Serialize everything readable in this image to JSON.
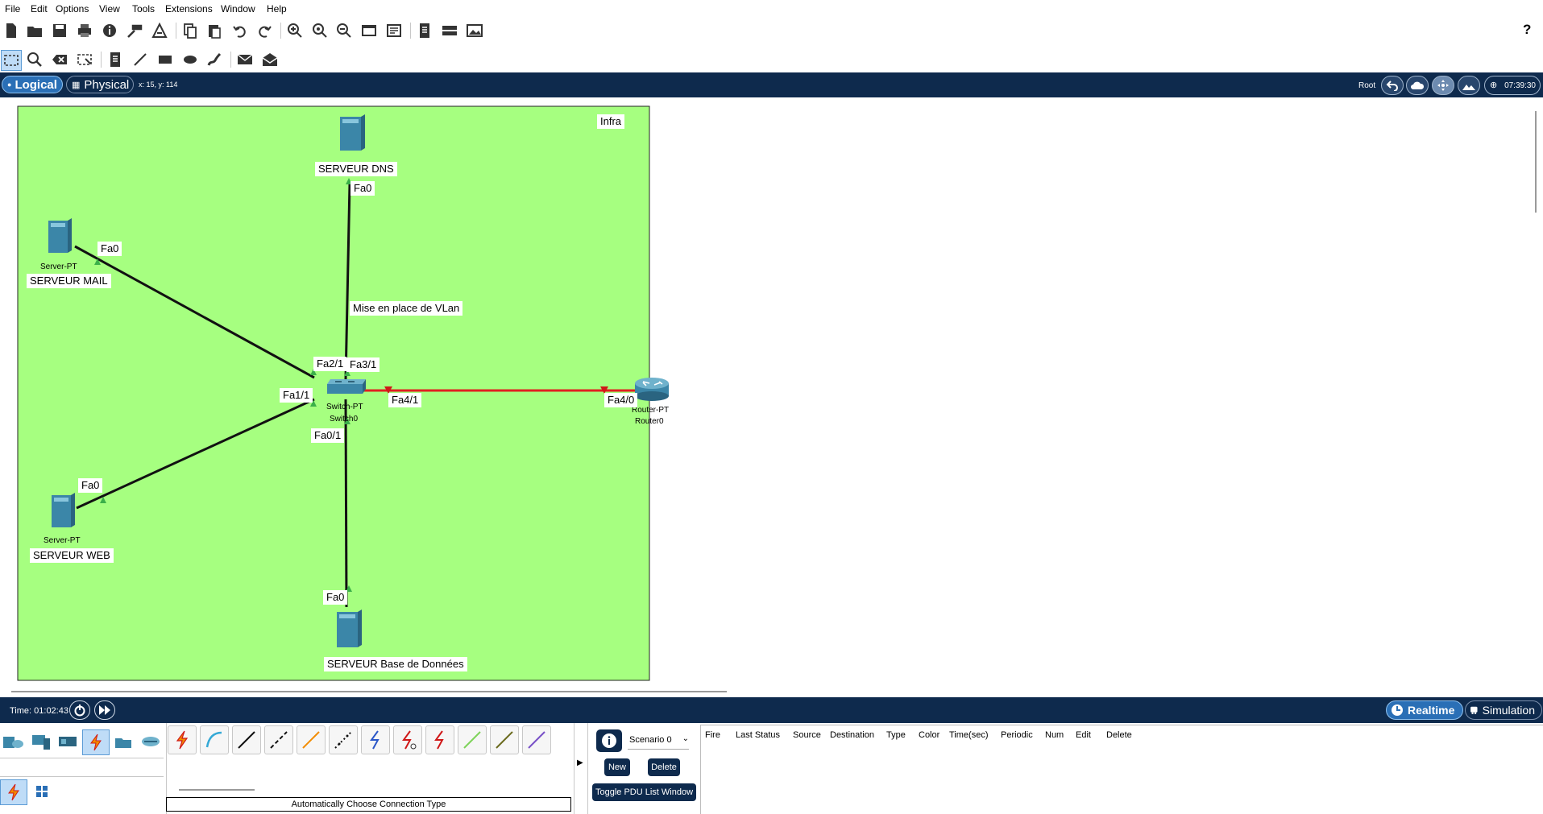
{
  "menu": [
    "File",
    "Edit",
    "Options",
    "View",
    "Tools",
    "Extensions",
    "Window",
    "Help"
  ],
  "help_symbol": "?",
  "mode_tabs": {
    "logical": "Logical",
    "physical": "Physical"
  },
  "coords": "x: 15, y: 114",
  "root_label": "Root",
  "clock": "07:39:30",
  "cluster_label": "Infra",
  "annotation": "Mise en place de VLan",
  "devices": {
    "dns": {
      "name": "SERVEUR DNS"
    },
    "mail": {
      "model": "Server-PT",
      "name": "SERVEUR MAIL"
    },
    "web": {
      "model": "Server-PT",
      "name": "SERVEUR WEB"
    },
    "db": {
      "name": "SERVEUR Base de Données"
    },
    "switch": {
      "model": "Switch-PT",
      "name": "Switch0"
    },
    "router": {
      "model": "Router-PT",
      "name": "Router0"
    }
  },
  "ports": {
    "dns_fa0": "Fa0",
    "mail_fa0": "Fa0",
    "web_fa0": "Fa0",
    "db_fa0": "Fa0",
    "sw_fa21": "Fa2/1",
    "sw_fa31": "Fa3/1",
    "sw_fa11": "Fa1/1",
    "sw_fa41": "Fa4/1",
    "sw_fa01": "Fa0/1",
    "rt_fa40": "Fa4/0"
  },
  "time": "Time: 01:02:43",
  "realtime": "Realtime",
  "simulation": "Simulation",
  "connection_label": "Automatically Choose Connection Type",
  "scenario": {
    "selected": "Scenario 0",
    "new": "New",
    "delete": "Delete",
    "toggle": "Toggle PDU List Window"
  },
  "pdu_columns": [
    "Fire",
    "Last Status",
    "Source",
    "Destination",
    "Type",
    "Color",
    "Time(sec)",
    "Periodic",
    "Num",
    "Edit",
    "Delete"
  ],
  "colors": {
    "workspace_green": "#a6ff80",
    "bar_navy": "#0e2a4d",
    "link_red": "#e02020",
    "link_black": "#111111"
  }
}
